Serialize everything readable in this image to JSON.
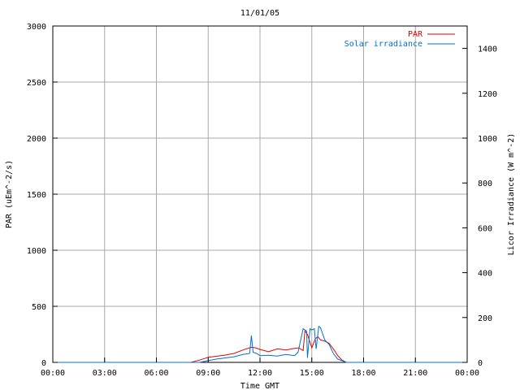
{
  "chart_data": {
    "type": "line",
    "title": "11/01/05",
    "xlabel": "Time GMT",
    "ylabel_left": "PAR (uEm^-2/s)",
    "ylabel_right": "Licor Irradiance (W m^-2)",
    "x_tick_labels": [
      "00:00",
      "03:00",
      "06:00",
      "09:00",
      "12:00",
      "15:00",
      "18:00",
      "21:00",
      "00:00"
    ],
    "x_tick_hours": [
      0,
      3,
      6,
      9,
      12,
      15,
      18,
      21,
      24
    ],
    "xlim_hours": [
      0,
      24
    ],
    "ylim_left": [
      0,
      3000
    ],
    "ylim_right": [
      0,
      1500
    ],
    "y_ticks_left": [
      0,
      500,
      1000,
      1500,
      2000,
      2500,
      3000
    ],
    "y_ticks_right": [
      0,
      200,
      400,
      600,
      800,
      1000,
      1200,
      1400
    ],
    "grid": true,
    "legend_position": "top-right",
    "series": [
      {
        "name": "PAR",
        "axis": "left",
        "color": "#e00000",
        "x_hours": [
          0,
          8.0,
          8.5,
          9.0,
          9.5,
          10.0,
          10.5,
          11.0,
          11.5,
          11.75,
          12.0,
          12.5,
          13.0,
          13.5,
          14.0,
          14.25,
          14.5,
          14.6,
          14.75,
          15.0,
          15.2,
          15.35,
          15.5,
          15.75,
          16.0,
          16.25,
          16.5,
          16.75,
          17.0,
          24.0
        ],
        "values": [
          0,
          0,
          20,
          45,
          55,
          65,
          80,
          110,
          135,
          130,
          115,
          95,
          120,
          110,
          125,
          130,
          105,
          280,
          250,
          130,
          210,
          230,
          200,
          190,
          170,
          120,
          60,
          20,
          0,
          0
        ]
      },
      {
        "name": "Solar irradiance",
        "axis": "right",
        "color": "#0070d0",
        "x_hours": [
          0,
          8.5,
          9.0,
          9.5,
          10.0,
          10.5,
          11.0,
          11.4,
          11.5,
          11.6,
          11.8,
          12.0,
          12.5,
          13.0,
          13.5,
          14.0,
          14.2,
          14.5,
          14.7,
          14.75,
          14.9,
          15.0,
          15.15,
          15.25,
          15.4,
          15.5,
          15.75,
          16.0,
          16.25,
          16.5,
          17.0,
          24.0
        ],
        "values": [
          0,
          0,
          8,
          15,
          20,
          25,
          35,
          40,
          120,
          45,
          40,
          30,
          32,
          28,
          35,
          30,
          45,
          150,
          140,
          20,
          150,
          145,
          150,
          60,
          160,
          155,
          100,
          80,
          40,
          15,
          0,
          0
        ]
      }
    ]
  }
}
